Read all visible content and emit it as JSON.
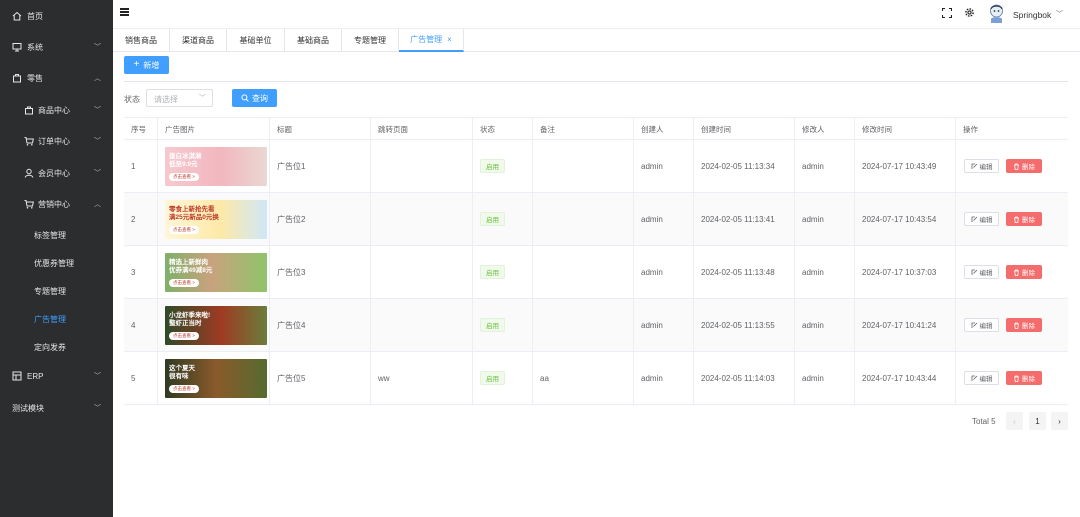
{
  "sidebar": {
    "items": [
      {
        "label": "首页",
        "icon": "home-icon"
      },
      {
        "label": "系统",
        "icon": "monitor-icon"
      },
      {
        "label": "零售",
        "icon": "store-icon"
      },
      {
        "label": "商品中心",
        "icon": "bag-icon"
      },
      {
        "label": "订单中心",
        "icon": "cart-icon"
      },
      {
        "label": "会员中心",
        "icon": "user-icon"
      },
      {
        "label": "营销中心",
        "icon": "cart-icon"
      },
      {
        "label": "标签管理"
      },
      {
        "label": "优惠券管理"
      },
      {
        "label": "专题管理"
      },
      {
        "label": "广告管理"
      },
      {
        "label": "定向发券"
      },
      {
        "label": "ERP",
        "icon": "erp-icon"
      },
      {
        "label": "测试模块"
      }
    ]
  },
  "header": {
    "username": "Springbok"
  },
  "tabs": [
    {
      "label": "销售商品"
    },
    {
      "label": "渠道商品"
    },
    {
      "label": "基础单位"
    },
    {
      "label": "基础商品"
    },
    {
      "label": "专题管理"
    },
    {
      "label": "广告管理",
      "close": "×"
    }
  ],
  "toolbar": {
    "add_label": "新增",
    "add_icon": "+",
    "status_label": "状态",
    "status_placeholder": "请选择",
    "query_label": "查询"
  },
  "table": {
    "columns": [
      "序号",
      "广告图片",
      "标题",
      "跳转页面",
      "状态",
      "备注",
      "创建人",
      "创建时间",
      "修改人",
      "修改时间",
      "操作"
    ],
    "edit_label": "编辑",
    "delete_label": "删除",
    "rows": [
      {
        "index": "1",
        "img_text": "蛋白冰淇淋\n低至9.9元",
        "img_btn": "点击查看 >",
        "title": "广告位1",
        "link": "",
        "status": "启用",
        "remark": "",
        "creator": "admin",
        "created": "2024-02-05 11:13:34",
        "modifier": "admin",
        "modified": "2024-07-17 10:43:49"
      },
      {
        "index": "2",
        "img_text": "零食上新抢先看\n满25元新品0元换",
        "img_btn": "点击查看 >",
        "title": "广告位2",
        "link": "",
        "status": "启用",
        "remark": "",
        "creator": "admin",
        "created": "2024-02-05 11:13:41",
        "modifier": "admin",
        "modified": "2024-07-17 10:43:54"
      },
      {
        "index": "3",
        "img_text": "精选上新鲜肉\n优券满49减8元",
        "img_btn": "点击查看 >",
        "title": "广告位3",
        "link": "",
        "status": "启用",
        "remark": "",
        "creator": "admin",
        "created": "2024-02-05 11:13:48",
        "modifier": "admin",
        "modified": "2024-07-17 10:37:03"
      },
      {
        "index": "4",
        "img_text": "小龙虾季来啦!\n螯虾正当时",
        "img_btn": "点击查看 >",
        "title": "广告位4",
        "link": "",
        "status": "启用",
        "remark": "",
        "creator": "admin",
        "created": "2024-02-05 11:13:55",
        "modifier": "admin",
        "modified": "2024-07-17 10:41:24"
      },
      {
        "index": "5",
        "img_text": "这个夏天\n很有味",
        "img_btn": "点击查看 >",
        "title": "广告位5",
        "link": "ww",
        "status": "启用",
        "remark": "aa",
        "creator": "admin",
        "created": "2024-02-05 11:14:03",
        "modifier": "admin",
        "modified": "2024-07-17 10:43:44"
      }
    ]
  },
  "pagination": {
    "total": "Total 5",
    "prev": "‹",
    "current": "1",
    "next": "›"
  },
  "colors": {
    "primary": "#409eff",
    "sidebar_bg": "#2b2d2f",
    "danger": "#f56c6c",
    "success": "#67c23a"
  }
}
